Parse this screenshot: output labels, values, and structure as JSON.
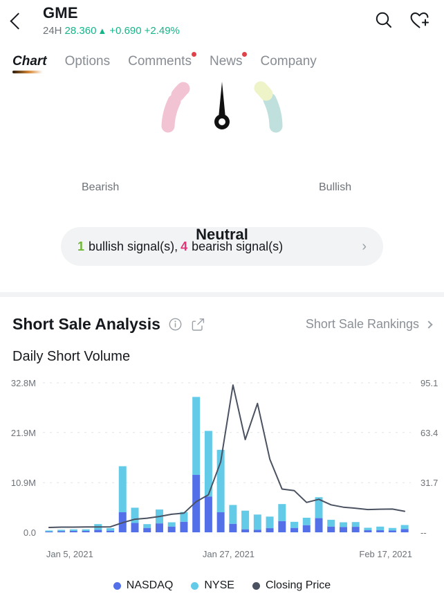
{
  "header": {
    "back_icon": "chevron-left-icon",
    "symbol": "GME",
    "period": "24H",
    "price": "28.360",
    "arrow": "▲",
    "change": "+0.690",
    "change_pct": "+2.49%",
    "price_color": "#13b589",
    "search_icon": "search-icon",
    "watchlist_icon": "heart-plus-icon"
  },
  "tabs": [
    {
      "label": "Chart",
      "active": true,
      "dot": false
    },
    {
      "label": "Options",
      "active": false,
      "dot": false
    },
    {
      "label": "Comments",
      "active": false,
      "dot": true
    },
    {
      "label": "News",
      "active": false,
      "dot": true
    },
    {
      "label": "Company",
      "active": false,
      "dot": false
    }
  ],
  "gauge": {
    "left_label": "Bearish",
    "right_label": "Bullish",
    "verdict": "Neutral",
    "bearish_color": "#f2c3d2",
    "bullish_color": "#bfe0dc",
    "bullish_top_color": "#eef3c8",
    "needle_color": "#111111"
  },
  "signal_pill": {
    "bullish_count": "1",
    "bullish_text": "bullish signal(s),",
    "bearish_count": "4",
    "bearish_text": "bearish signal(s)",
    "arrow": "›",
    "bullish_color": "#6fb536",
    "bearish_color": "#e0357a"
  },
  "short_sale": {
    "title": "Short Sale Analysis",
    "info_icon": "info-circle-icon",
    "share_icon": "share-icon",
    "rankings_label": "Short Sale Rankings",
    "rankings_chevron": "chevron-right-icon",
    "subtitle": "Daily Short Volume"
  },
  "chart_data": {
    "type": "bar",
    "title": "Daily Short Volume",
    "xlabel": "",
    "ylabel": "",
    "grid": true,
    "legend_position": "bottom",
    "y_left_ticks": [
      "32.8M",
      "21.9M",
      "10.9M",
      "0.0"
    ],
    "y_left_values": [
      32800000,
      21900000,
      10900000,
      0
    ],
    "y_right_ticks": [
      "95.1",
      "63.4",
      "31.7",
      "--"
    ],
    "y_right_values": [
      95.1,
      63.4,
      31.7,
      0
    ],
    "ylim": [
      0,
      32800000
    ],
    "ylim_right": [
      0,
      95.1
    ],
    "x_tick_labels": [
      "Jan 5, 2021",
      "Jan 27, 2021",
      "Feb 17, 2021"
    ],
    "x_tick_index": [
      0,
      15,
      30
    ],
    "stacked": true,
    "categories": [
      "Jan 5, 2021",
      "Jan 6, 2021",
      "Jan 7, 2021",
      "Jan 8, 2021",
      "Jan 11, 2021",
      "Jan 12, 2021",
      "Jan 13, 2021",
      "Jan 14, 2021",
      "Jan 15, 2021",
      "Jan 19, 2021",
      "Jan 20, 2021",
      "Jan 21, 2021",
      "Jan 22, 2021",
      "Jan 25, 2021",
      "Jan 26, 2021",
      "Jan 27, 2021",
      "Jan 28, 2021",
      "Jan 29, 2021",
      "Feb 1, 2021",
      "Feb 2, 2021",
      "Feb 3, 2021",
      "Feb 4, 2021",
      "Feb 5, 2021",
      "Feb 8, 2021",
      "Feb 9, 2021",
      "Feb 10, 2021",
      "Feb 11, 2021",
      "Feb 12, 2021",
      "Feb 16, 2021",
      "Feb 17, 2021"
    ],
    "series": [
      {
        "name": "NASDAQ",
        "color": "#5470e8",
        "values": [
          0.15,
          0.25,
          0.3,
          0.3,
          0.55,
          0.35,
          4.4,
          2.05,
          0.95,
          1.95,
          1.25,
          2.3,
          12.6,
          7.85,
          4.4,
          1.85,
          0.65,
          0.55,
          0.9,
          2.45,
          0.95,
          1.55,
          3.1,
          1.25,
          1.15,
          1.2,
          0.45,
          0.45,
          0.4,
          0.7
        ]
      },
      {
        "name": "NYSE",
        "color": "#63cbe8",
        "values": [
          0.25,
          0.3,
          0.35,
          0.35,
          1.25,
          0.55,
          10.1,
          3.35,
          0.85,
          3.05,
          0.95,
          2.15,
          17.1,
          14.4,
          13.7,
          4.15,
          4.1,
          3.35,
          2.55,
          3.75,
          1.35,
          1.65,
          4.6,
          1.5,
          1.05,
          1.05,
          0.55,
          0.8,
          0.55,
          0.9
        ]
      }
    ],
    "line_series": {
      "name": "Closing Price",
      "color": "#4a5160",
      "values": [
        3.1,
        3.3,
        3.3,
        3.4,
        3.4,
        3.5,
        6.1,
        8.3,
        9.0,
        10.1,
        11.5,
        12.2,
        19.5,
        23.9,
        44.8,
        93.7,
        59.0,
        82.0,
        46.6,
        27.5,
        26.5,
        19.0,
        21.0,
        17.5,
        16.0,
        15.3,
        14.5,
        14.7,
        14.8,
        13.4
      ]
    },
    "legend": [
      {
        "label": "NASDAQ",
        "color": "#5470e8"
      },
      {
        "label": "NYSE",
        "color": "#63cbe8"
      },
      {
        "label": "Closing Price",
        "color": "#4a5160"
      }
    ]
  }
}
